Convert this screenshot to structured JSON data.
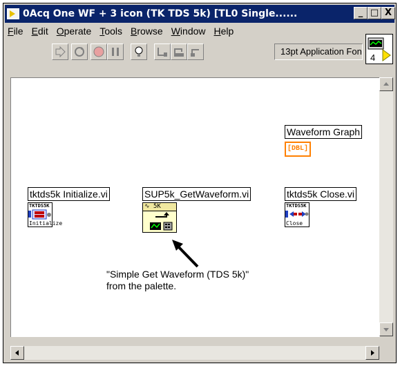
{
  "window": {
    "title": "0Acq One WF + 3 icon (TK TDS 5k) [TL0 Single......",
    "controls": [
      "_",
      "□",
      "X"
    ]
  },
  "menu": [
    "File",
    "Edit",
    "Operate",
    "Tools",
    "Browse",
    "Window",
    "Help"
  ],
  "toolbar": {
    "font": "13pt Application Fon",
    "connector_number": "4"
  },
  "diagram": {
    "graph_label": "Waveform Graph",
    "graph_terminal": "[DBL]",
    "nodes": [
      {
        "label": "tktds5k Initialize.vi",
        "header": "TKTDS5K",
        "footer": "Initialize"
      },
      {
        "label": "SUP5k_GetWaveform.vi",
        "header": "∿ 5K",
        "footer": ""
      },
      {
        "label": "tktds5k Close.vi",
        "header": "TKTDS5K",
        "footer": "Close"
      }
    ],
    "comment": "\"Simple Get Waveform (TDS 5k)\"\nfrom the palette."
  }
}
